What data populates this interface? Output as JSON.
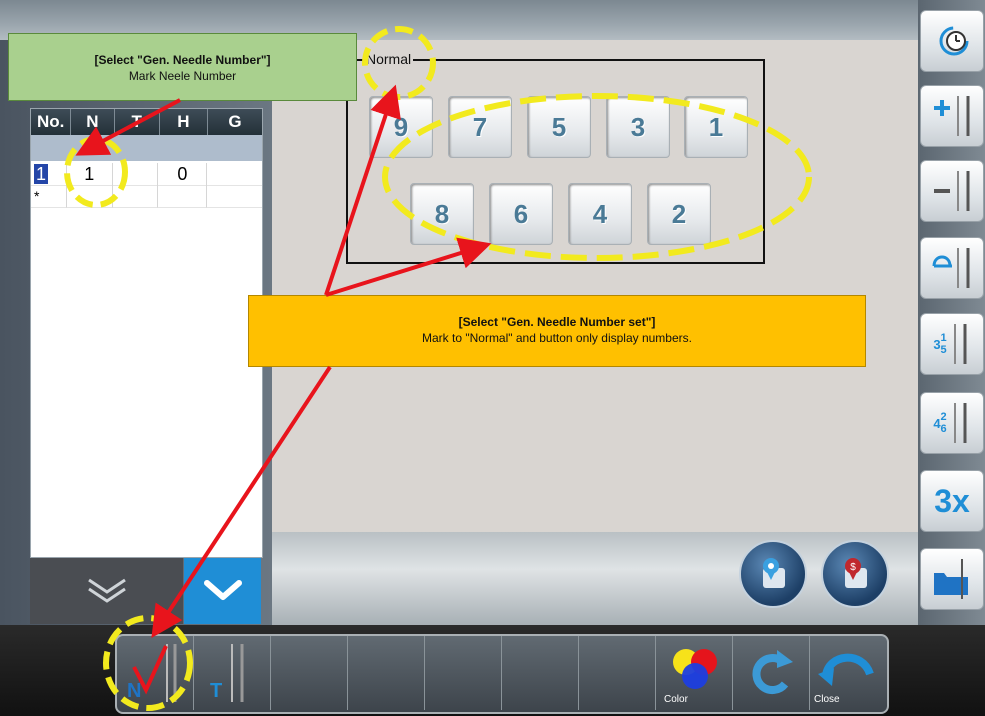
{
  "table": {
    "headers": [
      "No.",
      "N",
      "T",
      "H",
      "G"
    ],
    "rows": [
      {
        "no": "1",
        "n": "1",
        "t": "",
        "h": "0",
        "g": ""
      },
      {
        "no": "*",
        "n": "",
        "t": "",
        "h": "",
        "g": ""
      }
    ]
  },
  "needle_group": {
    "label": "Normal",
    "top_row": [
      "9",
      "7",
      "5",
      "3",
      "1"
    ],
    "bottom_row": [
      "8",
      "6",
      "4",
      "2"
    ]
  },
  "side_buttons": {
    "multiplier_label": "3x",
    "fraction_a": {
      "whole": "3",
      "num": "1",
      "den": "5"
    },
    "fraction_b": {
      "whole": "4",
      "num": "2",
      "den": "6"
    }
  },
  "bottom_toolbar": {
    "color_label": "Color",
    "close_label": "Close",
    "n_label": "N",
    "t_label": "T"
  },
  "callouts": {
    "green": {
      "title": "[Select \"Gen. Needle Number\"]",
      "body": "Mark Neele Number"
    },
    "orange": {
      "title": "[Select \"Gen. Needle Number set\"]",
      "body": "Mark to \"Normal\" and button only display numbers."
    }
  },
  "colors": {
    "annotation_arrow": "#e8141c",
    "highlight_ellipse": "#f2ea1e",
    "accent_blue": "#1f8ed6"
  }
}
